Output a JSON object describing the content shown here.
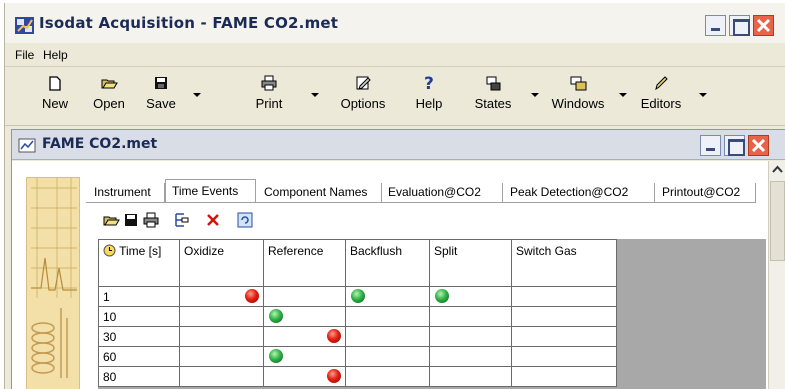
{
  "window": {
    "title": "Isodat Acquisition - FAME CO2.met"
  },
  "menu": {
    "items": [
      "File",
      "Help"
    ]
  },
  "toolbar": {
    "buttons": [
      {
        "label": "New",
        "icon": "new-document-icon"
      },
      {
        "label": "Open",
        "icon": "open-folder-icon"
      },
      {
        "label": "Save",
        "icon": "save-disk-icon"
      },
      {
        "label": "Print",
        "icon": "printer-icon"
      },
      {
        "label": "Options",
        "icon": "options-edit-icon"
      },
      {
        "label": "Help",
        "icon": "question-mark-icon"
      },
      {
        "label": "States",
        "icon": "states-icon"
      },
      {
        "label": "Windows",
        "icon": "windows-icon"
      },
      {
        "label": "Editors",
        "icon": "pencil-icon"
      }
    ]
  },
  "document": {
    "title": "FAME CO2.met",
    "tabs": [
      {
        "label": "Instrument",
        "active": false
      },
      {
        "label": "Time Events",
        "active": true
      },
      {
        "label": "Component Names",
        "active": false
      },
      {
        "label": "Evaluation@CO2",
        "active": false
      },
      {
        "label": "Peak Detection@CO2",
        "active": false
      },
      {
        "label": "Printout@CO2",
        "active": false
      }
    ],
    "inner_tools": [
      "open-icon",
      "save-icon",
      "print-icon",
      "insert-row-icon",
      "delete-icon",
      "refresh-icon"
    ],
    "grid": {
      "headers": [
        "Time [s]",
        "Oxidize",
        "Reference",
        "Backflush",
        "Split",
        "Switch Gas"
      ],
      "rows": [
        {
          "time": "1",
          "oxidize": "red",
          "reference": "",
          "backflush": "green",
          "split": "green",
          "switch_gas": ""
        },
        {
          "time": "10",
          "oxidize": "",
          "reference": "green",
          "backflush": "",
          "split": "",
          "switch_gas": ""
        },
        {
          "time": "30",
          "oxidize": "",
          "reference": "red",
          "backflush": "",
          "split": "",
          "switch_gas": ""
        },
        {
          "time": "60",
          "oxidize": "",
          "reference": "green",
          "backflush": "",
          "split": "",
          "switch_gas": ""
        },
        {
          "time": "80",
          "oxidize": "",
          "reference": "red",
          "backflush": "",
          "split": "",
          "switch_gas": ""
        }
      ]
    }
  },
  "colors": {
    "title_text": "#1b2b55",
    "on": "#2fb34a",
    "off": "#e21f12"
  }
}
